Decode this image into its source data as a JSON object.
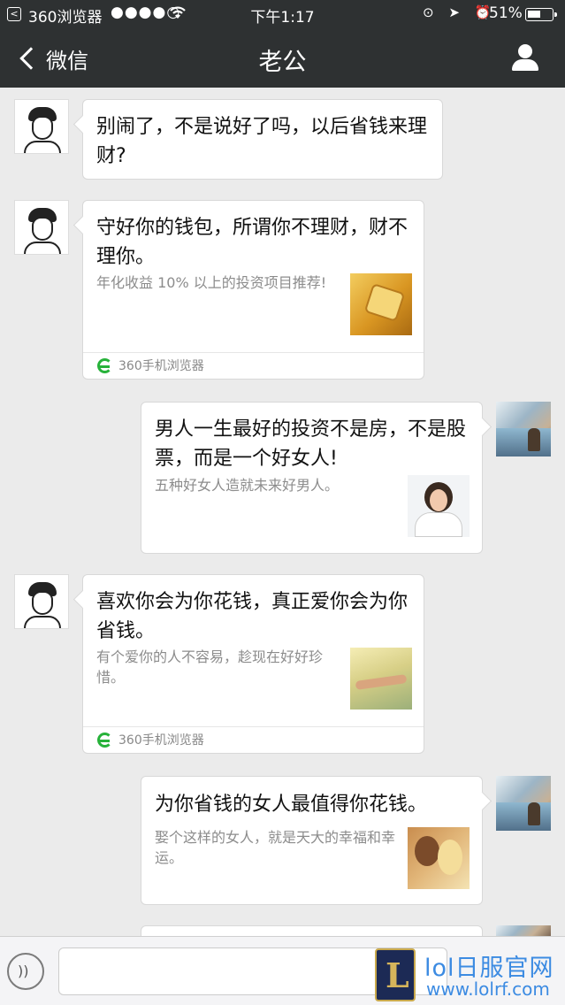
{
  "status_bar": {
    "app_name": "360浏览器",
    "signal": "●●●●○",
    "wifi_icon": "wifi-icon",
    "time": "下午1:17",
    "icons": "⊙ ➤ ⏰",
    "battery": "51%"
  },
  "nav": {
    "back_label": "微信",
    "title": "老公",
    "profile_icon": "person-icon"
  },
  "messages": [
    {
      "side": "left",
      "title": "别闹了，不是说好了吗，以后省钱来理财?"
    },
    {
      "side": "left",
      "title": "守好你的钱包，所谓你不理财，财不理你。",
      "desc": "年化收益 10% 以上的投资项目推荐!",
      "source": "360手机浏览器"
    },
    {
      "side": "right",
      "title": "男人一生最好的投资不是房，不是股票，而是一个好女人!",
      "desc": "五种好女人造就未来好男人。"
    },
    {
      "side": "left",
      "title": "喜欢你会为你花钱，真正爱你会为你省钱。",
      "desc": "有个爱你的人不容易，趁现在好好珍惜。",
      "source": "360手机浏览器"
    },
    {
      "side": "right",
      "title": "为你省钱的女人最值得你花钱。",
      "desc": "娶个这样的女人，就是天大的幸福和幸运。"
    }
  ],
  "input_bar": {
    "voice_icon": "voice-icon"
  },
  "watermark": {
    "logo_letter": "L",
    "title": "lol日服官网",
    "url": "www.lolrf.com"
  }
}
